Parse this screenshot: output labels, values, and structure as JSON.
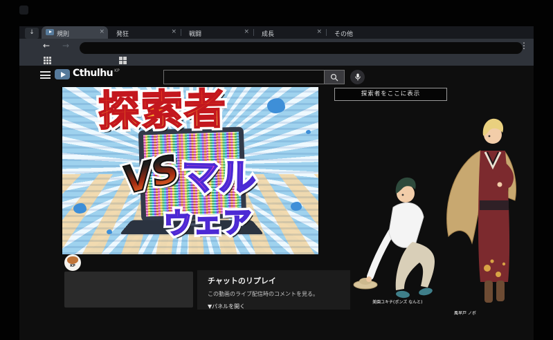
{
  "browser": {
    "tab_search_glyph": "↓",
    "tabs": [
      {
        "label": "規則"
      },
      {
        "label": "発狂"
      },
      {
        "label": "戦闘"
      },
      {
        "label": "成長"
      },
      {
        "label": "その他"
      }
    ],
    "tab_close_glyph": "×",
    "nav": {
      "back_glyph": "←",
      "forward_glyph": "→",
      "url_value": "",
      "menu_glyph": "⋮"
    }
  },
  "masthead": {
    "logo_text": "Cthulhu",
    "logo_badge": "KP",
    "search_value": "",
    "signin_button": "探索者をここに表示"
  },
  "video": {
    "thumbnail": {
      "line1": "探索者",
      "vs": "VS",
      "line2": "マル",
      "line3": "ウェア"
    },
    "channel_avatar_label": "KP"
  },
  "chat_replay": {
    "title": "チャットのリプレイ",
    "description": "この動画のライブ配信時のコメントを見る。",
    "open_panel": "▼パネルを開く"
  },
  "characters": {
    "left_caption": "美園ユキチ(ポンズ なんと)",
    "right_caption": "風早戸 ノボ"
  },
  "colors": {
    "logo_play_blue": "#567a9b",
    "thumb_bg_blue": "#9fd2ee",
    "thumb_ray_cream": "#f2d9ac",
    "title_gradient_top": "#e93a1c",
    "title_gradient_bottom": "#ffee4f",
    "malware_pink": "#ff49c9",
    "malware_blue": "#3136d6",
    "kimono_red": "#7c2a2e",
    "cape_tan": "#c8a870"
  }
}
